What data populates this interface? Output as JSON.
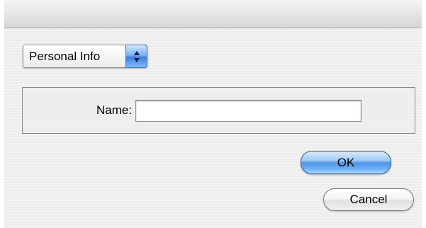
{
  "dialog": {
    "section_popup": {
      "selected": "Personal Info",
      "icon": "up-down-arrows-icon"
    },
    "form": {
      "name_label": "Name:",
      "name_value": ""
    },
    "buttons": {
      "ok_label": "OK",
      "cancel_label": "Cancel"
    }
  },
  "colors": {
    "default_button_accent": "#4f94ea",
    "window_background": "#eeeeee"
  }
}
